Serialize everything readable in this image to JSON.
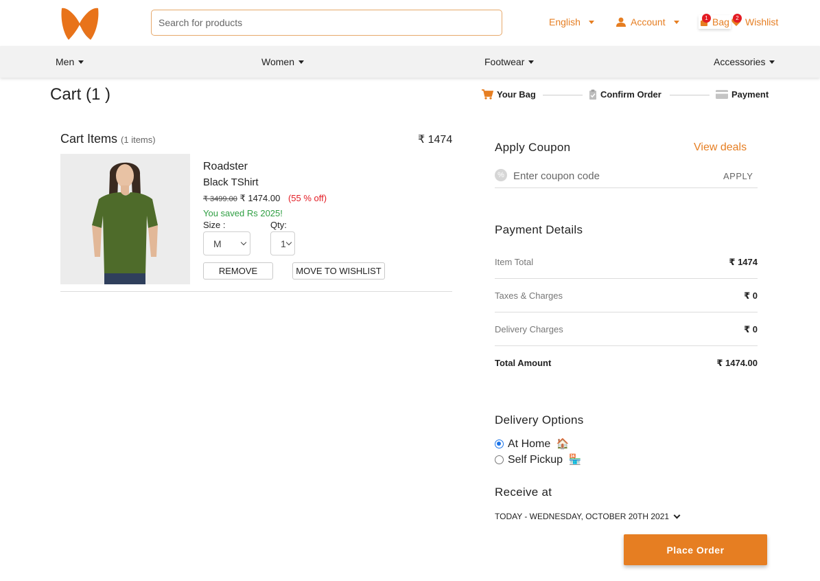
{
  "header": {
    "search_placeholder": "Search for products",
    "language": "English",
    "account": "Account",
    "bag": "Bag",
    "bag_count": "1",
    "wishlist": "Wishlist",
    "wishlist_count": "2"
  },
  "nav": {
    "items": [
      "Men",
      "Women",
      "Footwear",
      "Accessories"
    ]
  },
  "cart": {
    "title": "Cart (1 )",
    "steps": [
      "Your Bag",
      "Confirm Order",
      "Payment"
    ],
    "items_title": "Cart Items",
    "items_count": "(1 items)",
    "items_total": "₹ 1474",
    "item": {
      "brand": "Roadster",
      "name": "Black TShirt",
      "mrp": "₹ 3499.00",
      "price": "₹ 1474.00",
      "discount": "(55 % off)",
      "saved": "You saved Rs 2025!",
      "size_label": "Size :",
      "size_value": "M",
      "qty_label": "Qty:",
      "qty_value": "1",
      "remove": "REMOVE",
      "move_to_wishlist": "MOVE TO WISHLIST"
    }
  },
  "coupon": {
    "title": "Apply Coupon",
    "view_deals": "View deals",
    "placeholder": "Enter coupon code",
    "apply": "APPLY"
  },
  "payment": {
    "title": "Payment Details",
    "rows": [
      {
        "label": "Item Total",
        "value": "₹ 1474"
      },
      {
        "label": "Taxes & Charges",
        "value": "₹ 0"
      },
      {
        "label": "Delivery Charges",
        "value": "₹ 0"
      },
      {
        "label": "Total Amount",
        "value": "₹ 1474.00"
      }
    ]
  },
  "delivery": {
    "title": "Delivery Options",
    "options": [
      {
        "label": "At Home",
        "selected": true
      },
      {
        "label": "Self Pickup",
        "selected": false
      }
    ],
    "receive_title": "Receive at",
    "receive_date": "TODAY - WEDNESDAY, OCTOBER 20TH 2021"
  },
  "place_order": "Place Order",
  "colors": {
    "accent": "#e67e22",
    "badge": "#e31b23",
    "saved": "#2e9e42",
    "radio": "#1a73e8"
  }
}
